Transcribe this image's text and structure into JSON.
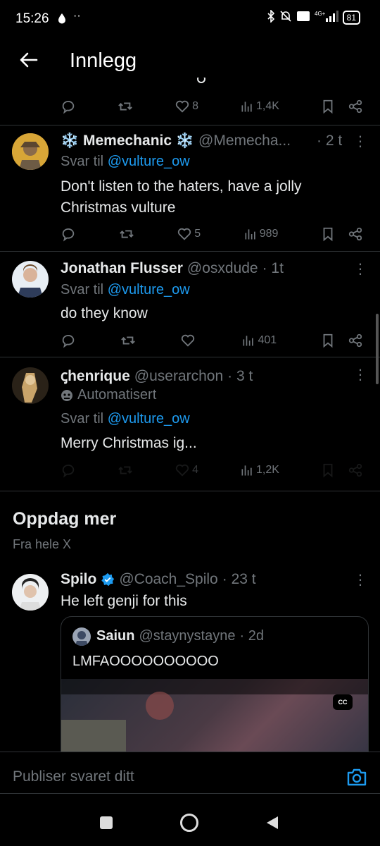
{
  "status": {
    "time": "15:26",
    "battery": "81"
  },
  "header": {
    "title": "Innlegg"
  },
  "top_actions": {
    "likes": "8",
    "views": "1,4K"
  },
  "posts": [
    {
      "name": "❄️ Memechanic ❄️",
      "handle": "@Memecha...",
      "time": "· 2 t",
      "reply_prefix": "Svar til ",
      "reply_user": "@vulture_ow",
      "text_1": "Don't listen to the haters, have a jolly",
      "text_2": "Christmas vulture",
      "likes": "5",
      "views": "989"
    },
    {
      "name": "Jonathan Flusser",
      "handle": "@osxdude",
      "time": "· 1t",
      "reply_prefix": "Svar til ",
      "reply_user": "@vulture_ow",
      "text_1": "do they know",
      "likes": "",
      "views": "401"
    },
    {
      "name": "ꞔhenrique",
      "handle": "@userarchon",
      "time": "· 3 t",
      "automated": "Automatisert",
      "reply_prefix": "Svar til ",
      "reply_user": "@vulture_ow",
      "text_1": "Merry Christmas ig...",
      "likes": "4",
      "views": "1,2K"
    }
  ],
  "discover": {
    "title": "Oppdag mer",
    "subtitle": "Fra hele X"
  },
  "spilo": {
    "name": "Spilo",
    "handle": "@Coach_Spilo",
    "time": "· 23 t",
    "text": "He left genji for this",
    "quote": {
      "name": "Saiun",
      "handle": "@staynystayne",
      "time": "· 2d",
      "text": "LMFAOOOOOOOOOO",
      "cc": "CC"
    }
  },
  "compose": {
    "placeholder": "Publiser svaret ditt"
  },
  "colors": {
    "accent": "#1d9bf0",
    "muted": "#71767b",
    "divider": "#2f3336"
  }
}
